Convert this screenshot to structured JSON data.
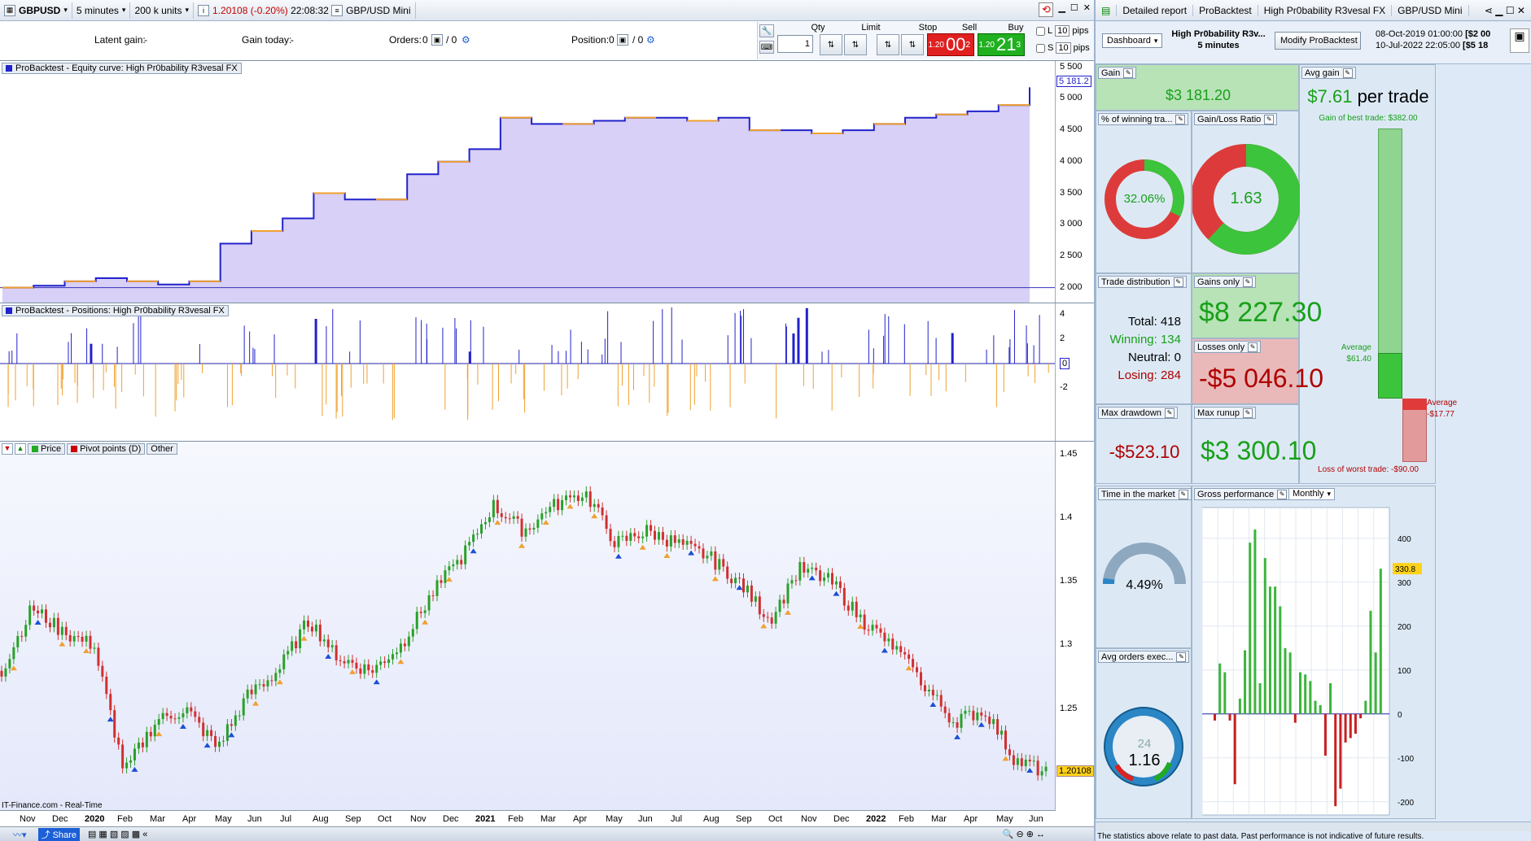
{
  "toolbar": {
    "instrument": "GBPUSD",
    "timeframe": "5 minutes",
    "units": "200 k units",
    "price": "1.20108",
    "change": "(-0.20%)",
    "time": "22:08:32",
    "instrument_name": "GBP/USD Mini"
  },
  "status": {
    "latent_label": "Latent gain:",
    "latent_value": "-",
    "today_label": "Gain today:",
    "today_value": "-",
    "orders_label": "Orders:",
    "orders_value": "0",
    "orders_value2": "/ 0",
    "position_label": "Position:",
    "position_value": "0",
    "position_value2": "/ 0"
  },
  "order": {
    "qty_label": "Qty",
    "qty_value": "1",
    "limit_label": "Limit",
    "stop_label": "Stop",
    "sell_label": "Sell",
    "buy_label": "Buy",
    "sell_small": "1.20",
    "sell_big": "00",
    "sell_sup": "2",
    "buy_small": "1.20",
    "buy_big": "21",
    "buy_sup": "3",
    "pips1": "10",
    "pips2": "10",
    "pips_label": "pips",
    "l_label": "L",
    "s_label": "S"
  },
  "panels": {
    "equity_title": "ProBacktest - Equity curve: High Pr0bability R3vesal FX",
    "positions_title": "ProBacktest - Positions: High Pr0bability R3vesal FX",
    "price_tab": "Price",
    "pivot_tab": "Pivot points (D)",
    "other_tab": "Other",
    "source": "IT-Finance.com - Real-Time",
    "equity_last": "5 181.2",
    "price_last": "1.20108",
    "zero_label": "0"
  },
  "equity_axis": [
    "5 500",
    "5 000",
    "4 500",
    "4 000",
    "3 500",
    "3 000",
    "2 500",
    "2 000"
  ],
  "pos_axis": [
    "4",
    "2",
    "-2"
  ],
  "price_axis": [
    "1.45",
    "1.4",
    "1.35",
    "1.3",
    "1.25"
  ],
  "x_axis": [
    "Nov",
    "Dec",
    "2020",
    "Feb",
    "Mar",
    "Apr",
    "May",
    "Jun",
    "Jul",
    "Aug",
    "Sep",
    "Oct",
    "Nov",
    "Dec",
    "2021",
    "Feb",
    "Mar",
    "Apr",
    "May",
    "Jun",
    "Jul",
    "Aug",
    "Sep",
    "Oct",
    "Nov",
    "Dec",
    "2022",
    "Feb",
    "Mar",
    "Apr",
    "May",
    "Jun"
  ],
  "report": {
    "tabs": [
      "Detailed report",
      "ProBacktest",
      "High Pr0bability R3vesal FX",
      "GBP/USD Mini"
    ],
    "view": "Dashboard",
    "system_name": "High Pr0bability R3v...",
    "system_tf": "5 minutes",
    "modify_button": "Modify ProBacktest",
    "date_from": "08-Oct-2019 01:00:00",
    "date_to": "10-Jul-2022 22:05:00",
    "amount1": "[$2 00",
    "amount2": "[$5 18"
  },
  "cards": {
    "gain_title": "Gain",
    "gain_value": "$3 181.20",
    "avg_title": "Avg gain",
    "avg_value": "$7.61",
    "avg_suffix": "per trade",
    "best_label": "Gain of best trade: $382.00",
    "worst_label": "Loss of worst trade: -$90.00",
    "avg_pos_label": "Average",
    "avg_pos_value": "$61.40",
    "avg_neg_label": "Average",
    "avg_neg_value": "-$17.77",
    "win_title": "% of winning tra...",
    "win_value": "32.06%",
    "win_ratio": 0.3206,
    "gl_title": "Gain/Loss Ratio",
    "gl_value": "1.63",
    "gl_ratio": 0.62,
    "dist_title": "Trade distribution",
    "total_label": "Total:",
    "total_value": "418",
    "winning_label": "Winning:",
    "winning_value": "134",
    "neutral_label": "Neutral:",
    "neutral_value": "0",
    "losing_label": "Losing:",
    "losing_value": "284",
    "gains_title": "Gains only",
    "gains_value": "$8 227.30",
    "losses_title": "Losses only",
    "losses_value": "-$5 046.10",
    "dd_title": "Max drawdown",
    "dd_value": "-$523.10",
    "runup_title": "Max runup",
    "runup_value": "$3 300.10",
    "market_title": "Time in the market",
    "market_value": "4.49%",
    "market_ratio": 0.0449,
    "orders_title": "Avg orders exec...",
    "orders_value": "1.16",
    "orders_badge": "24",
    "gross_title": "Gross performance",
    "gross_mode": "Monthly",
    "gross_last": "330.8",
    "gross_axis": [
      "400",
      "300",
      "200",
      "100",
      "0",
      "-100",
      "-200"
    ]
  },
  "footer": {
    "note": "The statistics above relate to past data. Past performance is not indicative of future results."
  },
  "chart_data": [
    {
      "type": "area",
      "title": "ProBacktest - Equity curve: High Pr0bability R3vesal FX",
      "y": [
        2000,
        2030,
        2100,
        2150,
        2100,
        2050,
        2100,
        2700,
        2900,
        3100,
        3500,
        3400,
        3400,
        3800,
        4000,
        4200,
        4700,
        4600,
        4600,
        4650,
        4700,
        4700,
        4650,
        4700,
        4500,
        4500,
        4450,
        4500,
        4600,
        4700,
        4750,
        4800,
        4900,
        5181.2
      ],
      "ylim": [
        1750,
        5600
      ]
    },
    {
      "type": "bar",
      "title": "ProBacktest - Positions: High Pr0bability R3vesal FX",
      "ylim": [
        -3,
        4
      ]
    },
    {
      "type": "line",
      "title": "Price",
      "y": [
        1.28,
        1.33,
        1.31,
        1.3,
        1.2,
        1.24,
        1.25,
        1.22,
        1.26,
        1.28,
        1.32,
        1.29,
        1.28,
        1.3,
        1.34,
        1.37,
        1.41,
        1.39,
        1.41,
        1.42,
        1.38,
        1.39,
        1.38,
        1.37,
        1.35,
        1.32,
        1.36,
        1.35,
        1.32,
        1.3,
        1.27,
        1.24,
        1.25,
        1.21,
        1.2
      ],
      "ylim": [
        1.17,
        1.46
      ]
    },
    {
      "type": "bar",
      "title": "Gross performance",
      "values": [
        -15,
        115,
        95,
        -15,
        -160,
        35,
        145,
        390,
        420,
        70,
        355,
        290,
        290,
        245,
        150,
        140,
        -20,
        95,
        90,
        75,
        30,
        20,
        -95,
        70,
        -210,
        -170,
        -65,
        -55,
        -45,
        -10,
        30,
        235,
        140,
        330.8
      ],
      "ylim": [
        -230,
        470
      ]
    }
  ]
}
